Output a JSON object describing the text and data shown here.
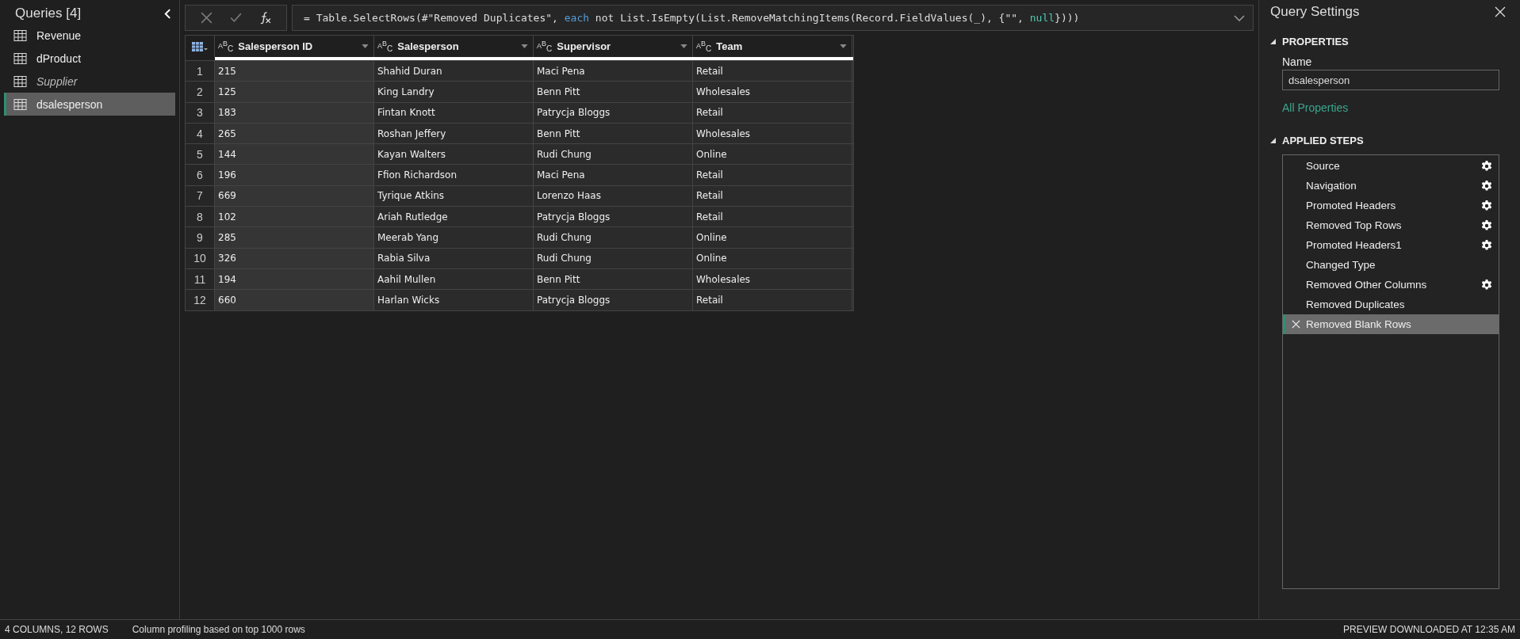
{
  "queries_panel": {
    "title": "Queries [4]",
    "items": [
      {
        "label": "Revenue",
        "selected": false,
        "loaded": true
      },
      {
        "label": "dProduct",
        "selected": false,
        "loaded": true
      },
      {
        "label": "Supplier",
        "selected": false,
        "loaded": false
      },
      {
        "label": "dsalesperson",
        "selected": true,
        "loaded": true
      }
    ]
  },
  "formula_bar": {
    "tokens": [
      {
        "text": "= Table.SelectRows(#\"Removed Duplicates\", ",
        "kind": "plain"
      },
      {
        "text": "each",
        "kind": "keyword"
      },
      {
        "text": " not List.IsEmpty(List.RemoveMatchingItems(Record.FieldValues(_), {\"\", ",
        "kind": "plain"
      },
      {
        "text": "null",
        "kind": "literal"
      },
      {
        "text": "})))",
        "kind": "plain"
      }
    ]
  },
  "table": {
    "columns": [
      {
        "label": "Salesperson ID",
        "type_letters": [
          "A",
          "B",
          "C"
        ]
      },
      {
        "label": "Salesperson",
        "type_letters": [
          "A",
          "B",
          "C"
        ]
      },
      {
        "label": "Supervisor",
        "type_letters": [
          "A",
          "B",
          "C"
        ]
      },
      {
        "label": "Team",
        "type_letters": [
          "A",
          "B",
          "C"
        ]
      }
    ],
    "rows": [
      {
        "index": "1",
        "cells": [
          "215",
          "Shahid Duran",
          "Maci Pena",
          "Retail"
        ]
      },
      {
        "index": "2",
        "cells": [
          "125",
          "King Landry",
          "Benn Pitt",
          "Wholesales"
        ]
      },
      {
        "index": "3",
        "cells": [
          "183",
          "Fintan Knott",
          "Patrycja Bloggs",
          "Retail"
        ]
      },
      {
        "index": "4",
        "cells": [
          "265",
          "Roshan Jeffery",
          "Benn Pitt",
          "Wholesales"
        ]
      },
      {
        "index": "5",
        "cells": [
          "144",
          "Kayan Walters",
          "Rudi Chung",
          "Online"
        ]
      },
      {
        "index": "6",
        "cells": [
          "196",
          "Ffion Richardson",
          "Maci Pena",
          "Retail"
        ]
      },
      {
        "index": "7",
        "cells": [
          "669",
          "Tyrique Atkins",
          "Lorenzo Haas",
          "Retail"
        ]
      },
      {
        "index": "8",
        "cells": [
          "102",
          "Ariah Rutledge",
          "Patrycja Bloggs",
          "Retail"
        ]
      },
      {
        "index": "9",
        "cells": [
          "285",
          "Meerab Yang",
          "Rudi Chung",
          "Online"
        ]
      },
      {
        "index": "10",
        "cells": [
          "326",
          "Rabia Silva",
          "Rudi Chung",
          "Online"
        ]
      },
      {
        "index": "11",
        "cells": [
          "194",
          "Aahil Mullen",
          "Benn Pitt",
          "Wholesales"
        ]
      },
      {
        "index": "12",
        "cells": [
          "660",
          "Harlan Wicks",
          "Patrycja Bloggs",
          "Retail"
        ]
      }
    ]
  },
  "query_settings": {
    "title": "Query Settings",
    "properties_heading": "PROPERTIES",
    "name_label": "Name",
    "name_value": "dsalesperson",
    "all_properties_link": "All Properties",
    "steps_heading": "APPLIED STEPS",
    "steps": [
      {
        "label": "Source",
        "has_settings": true,
        "selected": false
      },
      {
        "label": "Navigation",
        "has_settings": true,
        "selected": false
      },
      {
        "label": "Promoted Headers",
        "has_settings": true,
        "selected": false
      },
      {
        "label": "Removed Top Rows",
        "has_settings": true,
        "selected": false
      },
      {
        "label": "Promoted Headers1",
        "has_settings": true,
        "selected": false
      },
      {
        "label": "Changed Type",
        "has_settings": false,
        "selected": false
      },
      {
        "label": "Removed Other Columns",
        "has_settings": true,
        "selected": false
      },
      {
        "label": "Removed Duplicates",
        "has_settings": false,
        "selected": false
      },
      {
        "label": "Removed Blank Rows",
        "has_settings": false,
        "selected": true
      }
    ]
  },
  "status_bar": {
    "summary": "4 COLUMNS, 12 ROWS",
    "profiling": "Column profiling based on top 1000 rows",
    "preview": "PREVIEW DOWNLOADED AT 12:35 AM"
  }
}
